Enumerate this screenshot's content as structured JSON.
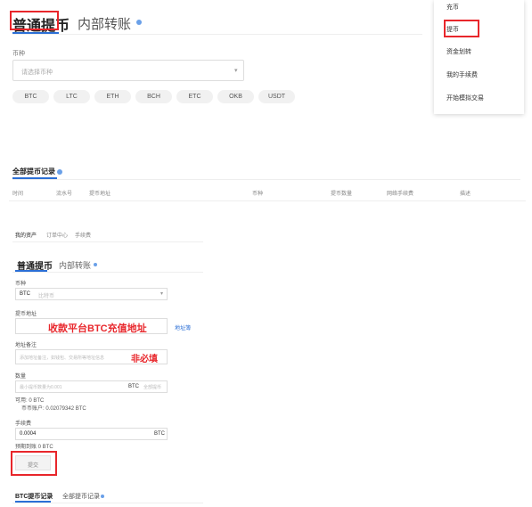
{
  "top": {
    "tab_withdraw": "普通提币",
    "tab_transfer": "内部转账",
    "coin_label": "币种",
    "coin_placeholder": "请选择币种",
    "coins": [
      "BTC",
      "LTC",
      "ETH",
      "BCH",
      "ETC",
      "OKB",
      "USDT"
    ]
  },
  "menu": {
    "items": [
      "充币",
      "提币",
      "资金划转",
      "我的手续费",
      "开始模拟交易"
    ]
  },
  "records": {
    "title": "全部提币记录",
    "columns": [
      "时间",
      "流水号",
      "提币地址",
      "币种",
      "提币数量",
      "网络手续费",
      "描述"
    ]
  },
  "bottom": {
    "nav": [
      "我的资产",
      "订单中心",
      "手续费"
    ],
    "tab_withdraw": "普通提币",
    "tab_transfer": "内部转账",
    "coin_label": "币种",
    "coin_value": "BTC",
    "coin_hint": "比特币",
    "address_label": "提币地址",
    "address_annotation": "收款平台BTC充值地址",
    "address_book": "地址簿",
    "memo_label": "地址备注",
    "memo_placeholder": "添加地址备注，如钱包、交易所等地址信息",
    "memo_annotation": "非必填",
    "amount_label": "数量",
    "amount_placeholder": "最小提币数量为0.001",
    "amount_unit": "BTC",
    "amount_all": "全部提币",
    "available": "可用: 0 BTC",
    "balance": "币币账户: 0.02079342 BTC",
    "fee_label": "手续费",
    "fee_value": "0.0004",
    "fee_unit": "BTC",
    "receive": "预期到账 0 BTC",
    "submit": "提交",
    "rec_tab1": "BTC提币记录",
    "rec_tab2": "全部提币记录"
  },
  "colors": {
    "accent": "#2b6fd6",
    "highlight": "#e8262b"
  }
}
